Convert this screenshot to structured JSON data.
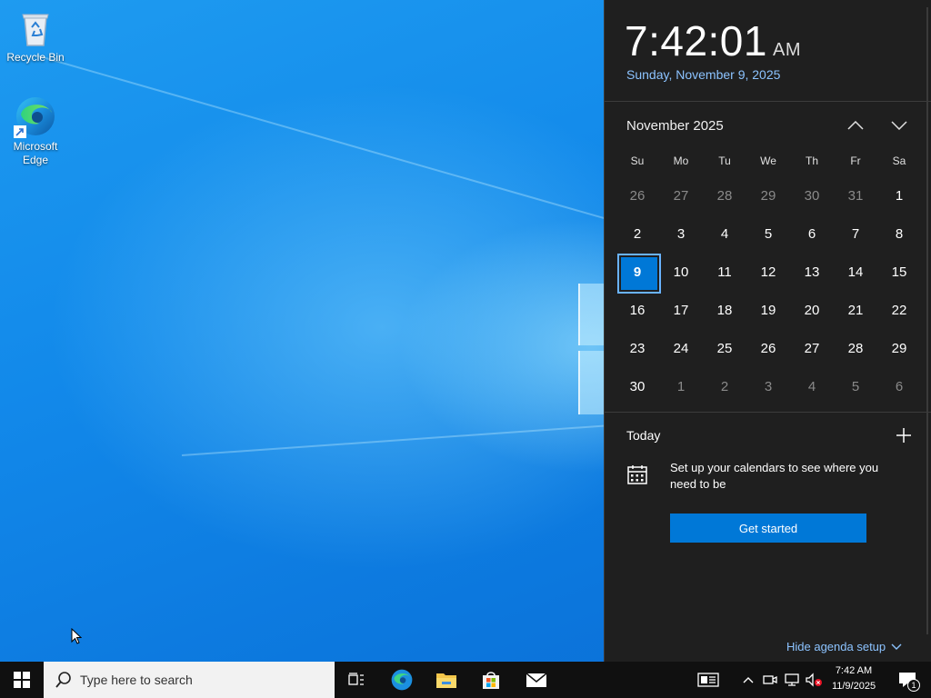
{
  "desktop": {
    "icons": [
      {
        "label": "Recycle Bin"
      },
      {
        "label": "Microsoft Edge"
      }
    ]
  },
  "flyout": {
    "time": "7:42:01",
    "ampm": "AM",
    "date": "Sunday, November 9, 2025",
    "month_label": "November 2025",
    "weekdays": [
      "Su",
      "Mo",
      "Tu",
      "We",
      "Th",
      "Fr",
      "Sa"
    ],
    "days": [
      {
        "n": "26",
        "other": true
      },
      {
        "n": "27",
        "other": true
      },
      {
        "n": "28",
        "other": true
      },
      {
        "n": "29",
        "other": true
      },
      {
        "n": "30",
        "other": true
      },
      {
        "n": "31",
        "other": true
      },
      {
        "n": "1"
      },
      {
        "n": "2"
      },
      {
        "n": "3"
      },
      {
        "n": "4"
      },
      {
        "n": "5"
      },
      {
        "n": "6"
      },
      {
        "n": "7"
      },
      {
        "n": "8"
      },
      {
        "n": "9",
        "today": true
      },
      {
        "n": "10"
      },
      {
        "n": "11"
      },
      {
        "n": "12"
      },
      {
        "n": "13"
      },
      {
        "n": "14"
      },
      {
        "n": "15"
      },
      {
        "n": "16"
      },
      {
        "n": "17"
      },
      {
        "n": "18"
      },
      {
        "n": "19"
      },
      {
        "n": "20"
      },
      {
        "n": "21"
      },
      {
        "n": "22"
      },
      {
        "n": "23"
      },
      {
        "n": "24"
      },
      {
        "n": "25"
      },
      {
        "n": "26"
      },
      {
        "n": "27"
      },
      {
        "n": "28"
      },
      {
        "n": "29"
      },
      {
        "n": "30"
      },
      {
        "n": "1",
        "other": true
      },
      {
        "n": "2",
        "other": true
      },
      {
        "n": "3",
        "other": true
      },
      {
        "n": "4",
        "other": true
      },
      {
        "n": "5",
        "other": true
      },
      {
        "n": "6",
        "other": true
      }
    ],
    "agenda": {
      "today_label": "Today",
      "message": "Set up your calendars to see where you need to be",
      "button": "Get started",
      "hide_label": "Hide agenda setup"
    },
    "colors": {
      "accent": "#0078d7",
      "link": "#8cc3ff",
      "panel": "#1f1f1f"
    }
  },
  "taskbar": {
    "search_placeholder": "Type here to search",
    "clock_time": "7:42 AM",
    "clock_date": "11/9/2025",
    "notification_count": "1",
    "pinned": [
      "task-view-icon",
      "edge-icon",
      "file-explorer-icon",
      "store-icon",
      "mail-icon"
    ],
    "tray": [
      "news-icon",
      "chevron-up-icon",
      "meet-icon",
      "network-icon",
      "volume-muted-icon"
    ]
  }
}
